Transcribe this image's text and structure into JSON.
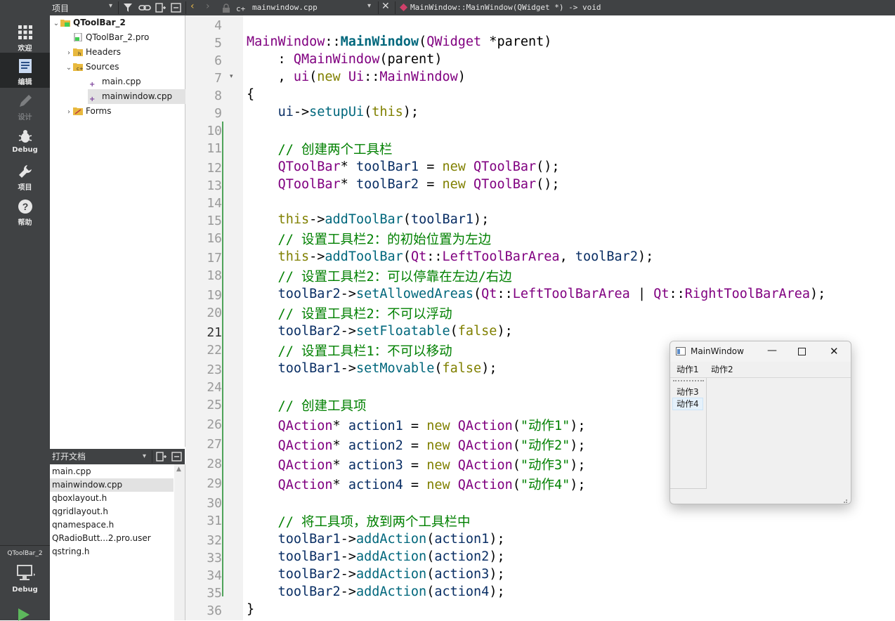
{
  "topbar": {
    "project_label": "项目",
    "file_tab": "mainwindow.cpp",
    "function_crumb": "MainWindow::MainWindow(QWidget *) -> void"
  },
  "modebar": {
    "items": [
      {
        "label": "欢迎",
        "icon": "grid-icon"
      },
      {
        "label": "编辑",
        "icon": "edit-document-icon"
      },
      {
        "label": "设计",
        "icon": "pencil-icon"
      },
      {
        "label": "Debug",
        "icon": "bug-icon"
      },
      {
        "label": "项目",
        "icon": "wrench-icon"
      },
      {
        "label": "帮助",
        "icon": "help-icon"
      }
    ],
    "kit_label": "QToolBar_2",
    "kit_mode": "Debug"
  },
  "tree": {
    "project": "QToolBar_2",
    "pro_file": "QToolBar_2.pro",
    "headers": "Headers",
    "sources": "Sources",
    "main_cpp": "main.cpp",
    "mainwindow_cpp": "mainwindow.cpp",
    "forms": "Forms"
  },
  "open_docs": {
    "title": "打开文档",
    "items": [
      "main.cpp",
      "mainwindow.cpp",
      "qboxlayout.h",
      "qgridlayout.h",
      "qnamespace.h",
      "QRadioButt...2.pro.user",
      "qstring.h"
    ]
  },
  "editor": {
    "line_numbers": [
      "4",
      "5",
      "6",
      "7",
      "8",
      "9",
      "10",
      "11",
      "12",
      "13",
      "14",
      "15",
      "16",
      "17",
      "18",
      "19",
      "20",
      "21",
      "22",
      "23",
      "24",
      "25",
      "26",
      "27",
      "28",
      "29",
      "30",
      "31",
      "32",
      "33",
      "34",
      "35",
      "36"
    ],
    "current_line": "21"
  },
  "preview_window": {
    "title": "MainWindow",
    "toolbar1": [
      "动作1",
      "动作2"
    ],
    "toolbar2": [
      "动作3",
      "动作4"
    ]
  }
}
